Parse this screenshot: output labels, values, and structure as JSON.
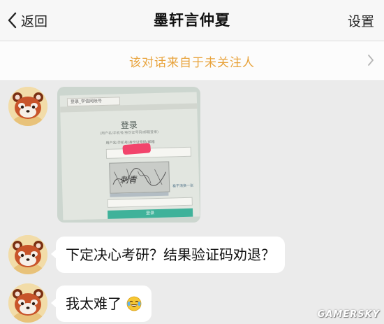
{
  "header": {
    "back_label": "返回",
    "title": "墨轩言仲夏",
    "settings_label": "设置"
  },
  "notice": {
    "text": "该对话来自于未关注人"
  },
  "messages": [
    {
      "type": "image",
      "description_icon": "photo-of-login-screen",
      "screen": {
        "tab_text": "登录_学信网账号",
        "login_title": "登录",
        "subtitle": "(用户名/手机号/身份证号码/邮箱登录)",
        "field_label": "用户名/手机号/身份证号码/邮箱",
        "refresh_text": "看不清换一张",
        "button_label": "登录"
      }
    },
    {
      "type": "text",
      "text": "下定决心考研？结果验证码劝退？"
    },
    {
      "type": "text",
      "text": "我太难了",
      "emoji": "crying-laughing-emoji"
    }
  ],
  "colors": {
    "notice_text": "#e8a33c",
    "login_button": "#3fb29a",
    "background": "#ebebeb"
  },
  "watermark": "GAMERSKY"
}
